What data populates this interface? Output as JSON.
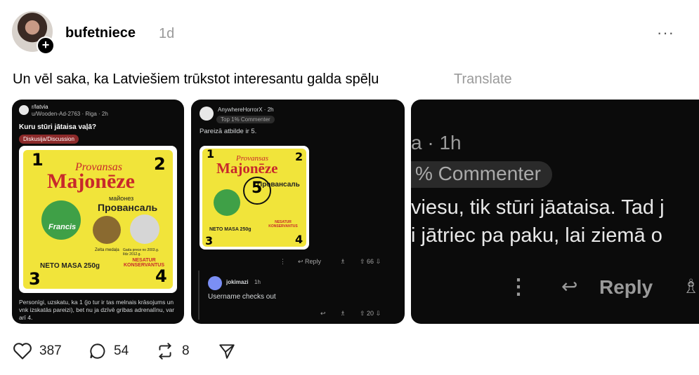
{
  "post": {
    "username": "bufetniece",
    "time": "1d",
    "more": "···",
    "text": "Un vēl saka, ka Latviešiem trūkstot interesantu galda spēļu",
    "translate": "Translate"
  },
  "card1": {
    "subreddit": "r/latvia",
    "author": "u/Wooden-Ad-2763 · Riga · 2h",
    "title": "Kuru stūri jātaisa vaļā?",
    "flair": "Diskusija/Discussion",
    "body": "Personīgi, uzskatu, ka 1 (jo tur ir tas melnais krāsojums un vnk izskatās pareizi), bet nu ja dzīvē gribas adrenalīnu, var arī 4."
  },
  "mayo": {
    "brand_top": "Provansas",
    "brand_main": "Majonēze",
    "ru_small": "майонез",
    "ru_main": "Провансаль",
    "logo": "Francis",
    "medal": "Zelta medaļa",
    "quality": "Gada prece no 2003.g. līdz 2012.g.",
    "neto": "NETO MASA 250g",
    "nesatur": "NESATUR KONSERVANTUS",
    "n1": "1",
    "n2": "2",
    "n3": "3",
    "n4": "4",
    "n5": "5"
  },
  "card2": {
    "author": "AnywhereHorrorX · 2h",
    "badge": "Top 1% Commenter",
    "comment": "Pareizā atbilde ir 5.",
    "reply": "Reply",
    "votes": "66",
    "reply_author": "jokimazi",
    "reply_time": "1h",
    "reply_text": "Username checks out",
    "reply_votes": "20"
  },
  "card3": {
    "time": "a · 1h",
    "badge": "% Commenter",
    "line1": "viesu, tik stūri jāataisa. Tad j",
    "line2": "i jātriec pa paku, lai ziemā o",
    "reply": "Reply"
  },
  "footer": {
    "likes": "387",
    "comments": "54",
    "reposts": "8"
  }
}
